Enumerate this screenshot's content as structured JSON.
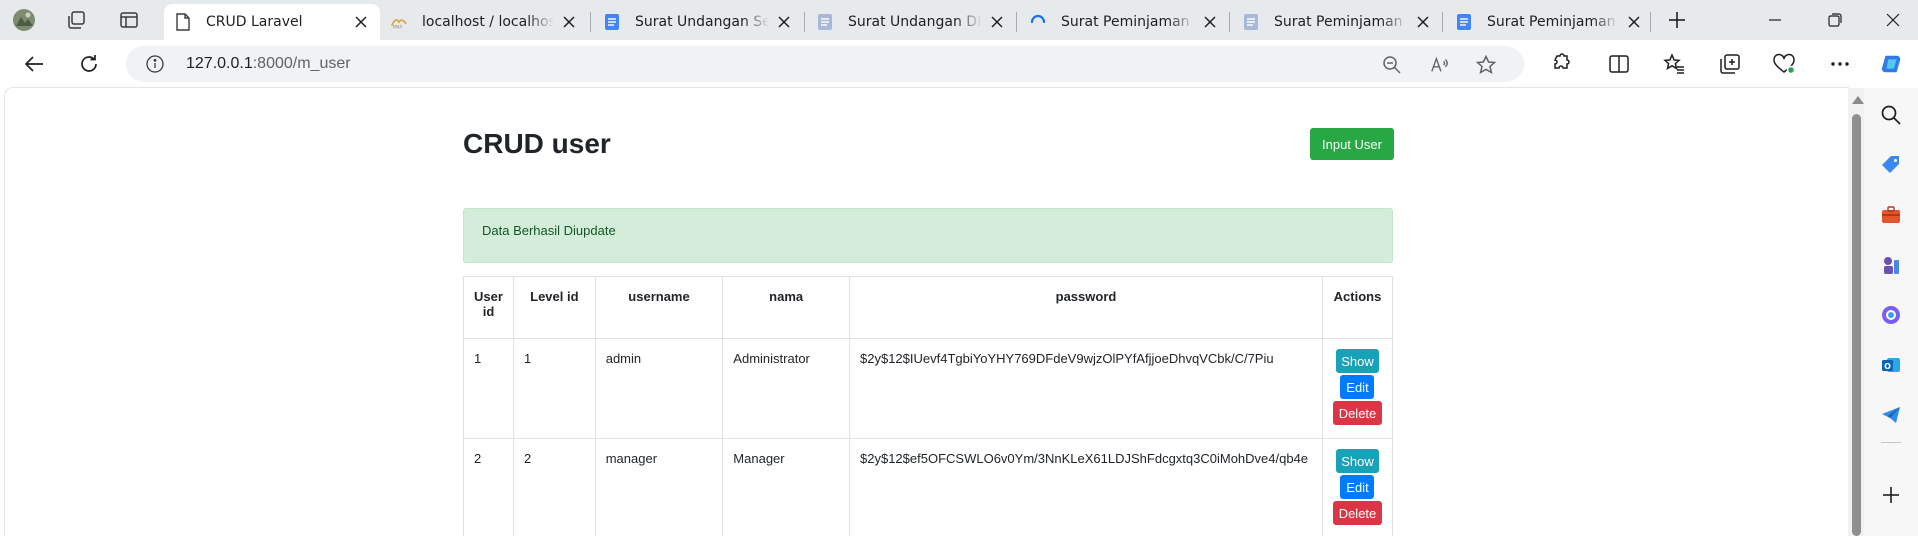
{
  "browser": {
    "tabs": [
      {
        "label": "CRUD Laravel",
        "active": true,
        "favicon": "page-icon"
      },
      {
        "label": "localhost / localhost",
        "active": false,
        "favicon": "phpmyadmin-icon"
      },
      {
        "label": "Surat Undangan Sel",
        "active": false,
        "favicon": "docs-icon"
      },
      {
        "label": "Surat Undangan DP",
        "active": false,
        "favicon": "docs-icon-gray"
      },
      {
        "label": "Surat Peminjaman B",
        "active": false,
        "favicon": "loading-icon"
      },
      {
        "label": "Surat Peminjaman B",
        "active": false,
        "favicon": "docs-icon-gray"
      },
      {
        "label": "Surat Peminjaman B",
        "active": false,
        "favicon": "docs-icon"
      }
    ],
    "address": {
      "host": "127.0.0.1",
      "path": ":8000/m_user"
    }
  },
  "page": {
    "title": "CRUD user",
    "input_button": "Input User",
    "alert": "Data Berhasil Diupdate",
    "table": {
      "headers": [
        "User id",
        "Level id",
        "username",
        "nama",
        "password",
        "Actions"
      ],
      "rows": [
        {
          "user_id": "1",
          "level_id": "1",
          "username": "admin",
          "nama": "Administrator",
          "password": "$2y$12$IUevf4TgbiYoYHY769DFdeV9wjzOlPYfAfjjoeDhvqVCbk/C/7Piu"
        },
        {
          "user_id": "2",
          "level_id": "2",
          "username": "manager",
          "nama": "Manager",
          "password": "$2y$12$ef5OFCSWLO6v0Ym/3NnKLeX61LDJShFdcgxtq3C0iMohDve4/qb4e"
        }
      ],
      "actions": {
        "show": "Show",
        "edit": "Edit",
        "delete": "Delete"
      }
    }
  },
  "colors": {
    "success": "#28a745",
    "info": "#17a2b8",
    "primary": "#007bff",
    "danger": "#dc3545",
    "alert_bg": "#d4edda",
    "alert_text": "#155724"
  }
}
